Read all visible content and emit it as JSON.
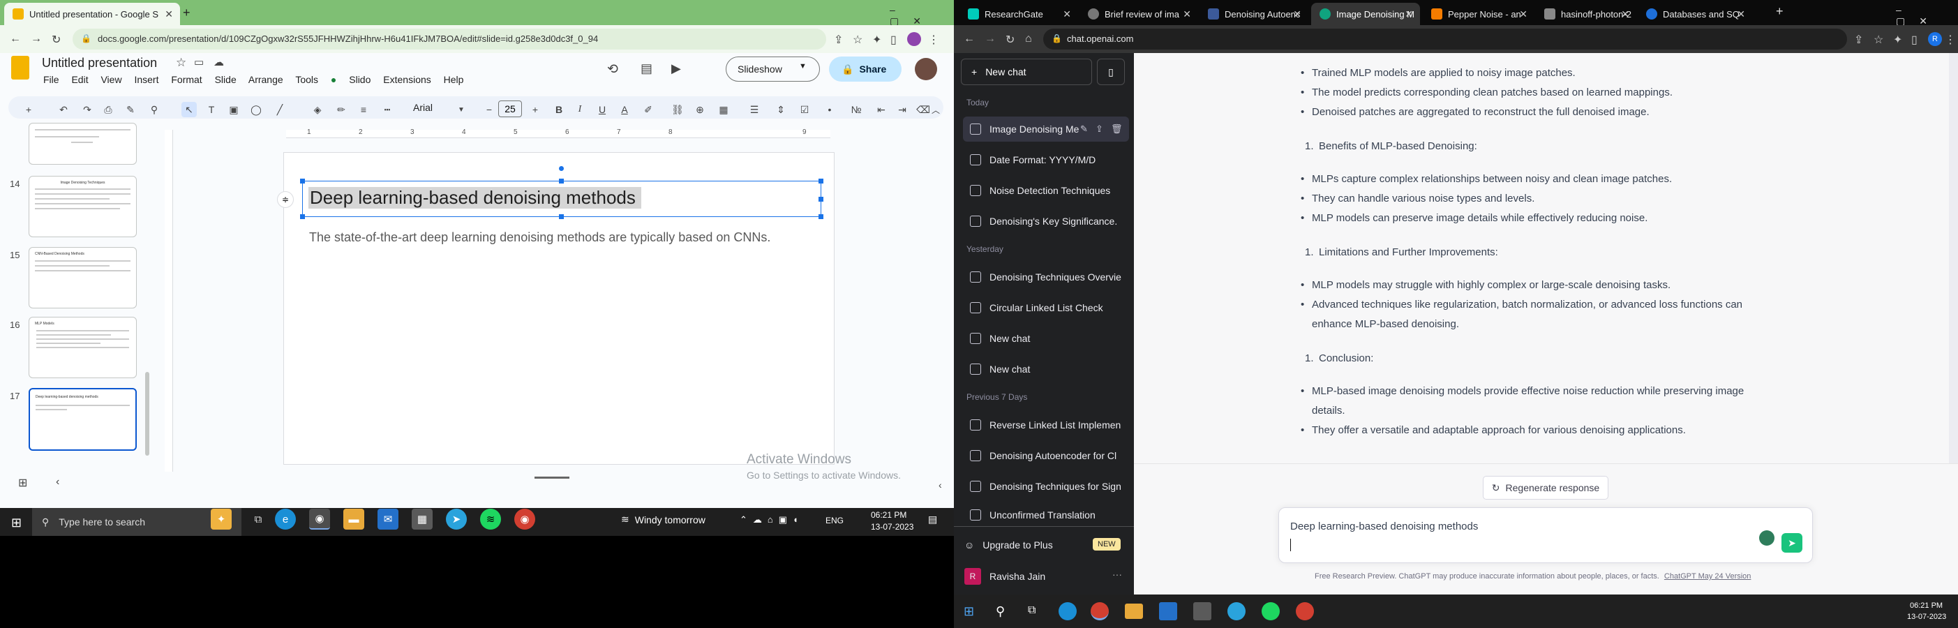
{
  "left_browser": {
    "tab_title": "Untitled presentation - Google S",
    "url": "docs.google.com/presentation/d/109CZgOgxw32rS55JFHHWZihjHhrw-H6u41IFkJM7BOA/edit#slide=id.g258e3d0dc3f_0_94",
    "new_tab_symbol": "+"
  },
  "slides_app": {
    "doc_title": "Untitled presentation",
    "menu": [
      "File",
      "Edit",
      "View",
      "Insert",
      "Format",
      "Slide",
      "Arrange",
      "Tools",
      "Slido",
      "Extensions",
      "Help"
    ],
    "slideshow_label": "Slideshow",
    "share_label": "Share",
    "font_name": "Arial",
    "font_size": "25",
    "ruler_marks": [
      "1",
      "2",
      "3",
      "4",
      "5",
      "6",
      "7",
      "8",
      "9"
    ],
    "thumbs": [
      {
        "num": "14",
        "title": "Image Denoising Techniques"
      },
      {
        "num": "15",
        "title": "CNN-Based Denoising Methods"
      },
      {
        "num": "16",
        "title": "MLP Models"
      },
      {
        "num": "17",
        "title": "Deep learning-based denoising methods"
      }
    ],
    "slide_title": "Deep learning-based denoising methods",
    "slide_body": "The state-of-the-art deep learning denoising methods are typically based on CNNs.",
    "activate_title": "Activate Windows",
    "activate_sub": "Go to Settings to activate Windows."
  },
  "left_taskbar": {
    "search_placeholder": "Type here to search",
    "weather": "Windy tomorrow",
    "lang": "ENG",
    "time": "06:21 PM",
    "date": "13-07-2023"
  },
  "right_browser": {
    "tabs": [
      "ResearchGate",
      "Brief review of ima",
      "Denoising Autoenc",
      "Image Denoising M",
      "Pepper Noise - an",
      "hasinoff-photon-2",
      "Databases and SQ"
    ],
    "url": "chat.openai.com"
  },
  "chatgpt": {
    "new_chat": "New chat",
    "sections": {
      "today": "Today",
      "yesterday": "Yesterday",
      "prev7": "Previous 7 Days"
    },
    "today_items": [
      "Image Denoising Me",
      "Date Format: YYYY/M/D",
      "Noise Detection Techniques",
      "Denoising's Key Significance."
    ],
    "yesterday_items": [
      "Denoising Techniques Overvie",
      "Circular Linked List Check",
      "New chat",
      "New chat"
    ],
    "prev7_items": [
      "Reverse Linked List Implemen",
      "Denoising Autoencoder for Cl",
      "Denoising Techniques for Sign",
      "Unconfirmed Translation"
    ],
    "upgrade": "Upgrade to Plus",
    "new_badge": "NEW",
    "user_initial": "R",
    "user_name": "Ravisha Jain",
    "answer": {
      "b1": [
        "Trained MLP models are applied to noisy image patches.",
        "The model predicts corresponding clean patches based on learned mappings.",
        "Denoised patches are aggregated to reconstruct the full denoised image."
      ],
      "h2": "Benefits of MLP-based Denoising:",
      "b2": [
        "MLPs capture complex relationships between noisy and clean image patches.",
        "They can handle various noise types and levels.",
        "MLP models can preserve image details while effectively reducing noise."
      ],
      "h3": "Limitations and Further Improvements:",
      "b3a": "MLP models may struggle with highly complex or large-scale denoising tasks.",
      "b3b": "Advanced techniques like regularization, batch normalization, or advanced loss functions can enhance MLP-based denoising.",
      "h4": "Conclusion:",
      "b4a": "MLP-based image denoising models provide effective noise reduction while preserving image details.",
      "b4b": "They offer a versatile and adaptable approach for various denoising applications.",
      "num_label": "1."
    },
    "regenerate": "Regenerate response",
    "input_text": "Deep learning-based denoising methods",
    "footer": "Free Research Preview. ChatGPT may produce inaccurate information about people, places, or facts.",
    "footer_link": "ChatGPT May 24 Version"
  },
  "right_taskbar": {
    "time": "06:21 PM",
    "date": "13-07-2023"
  }
}
